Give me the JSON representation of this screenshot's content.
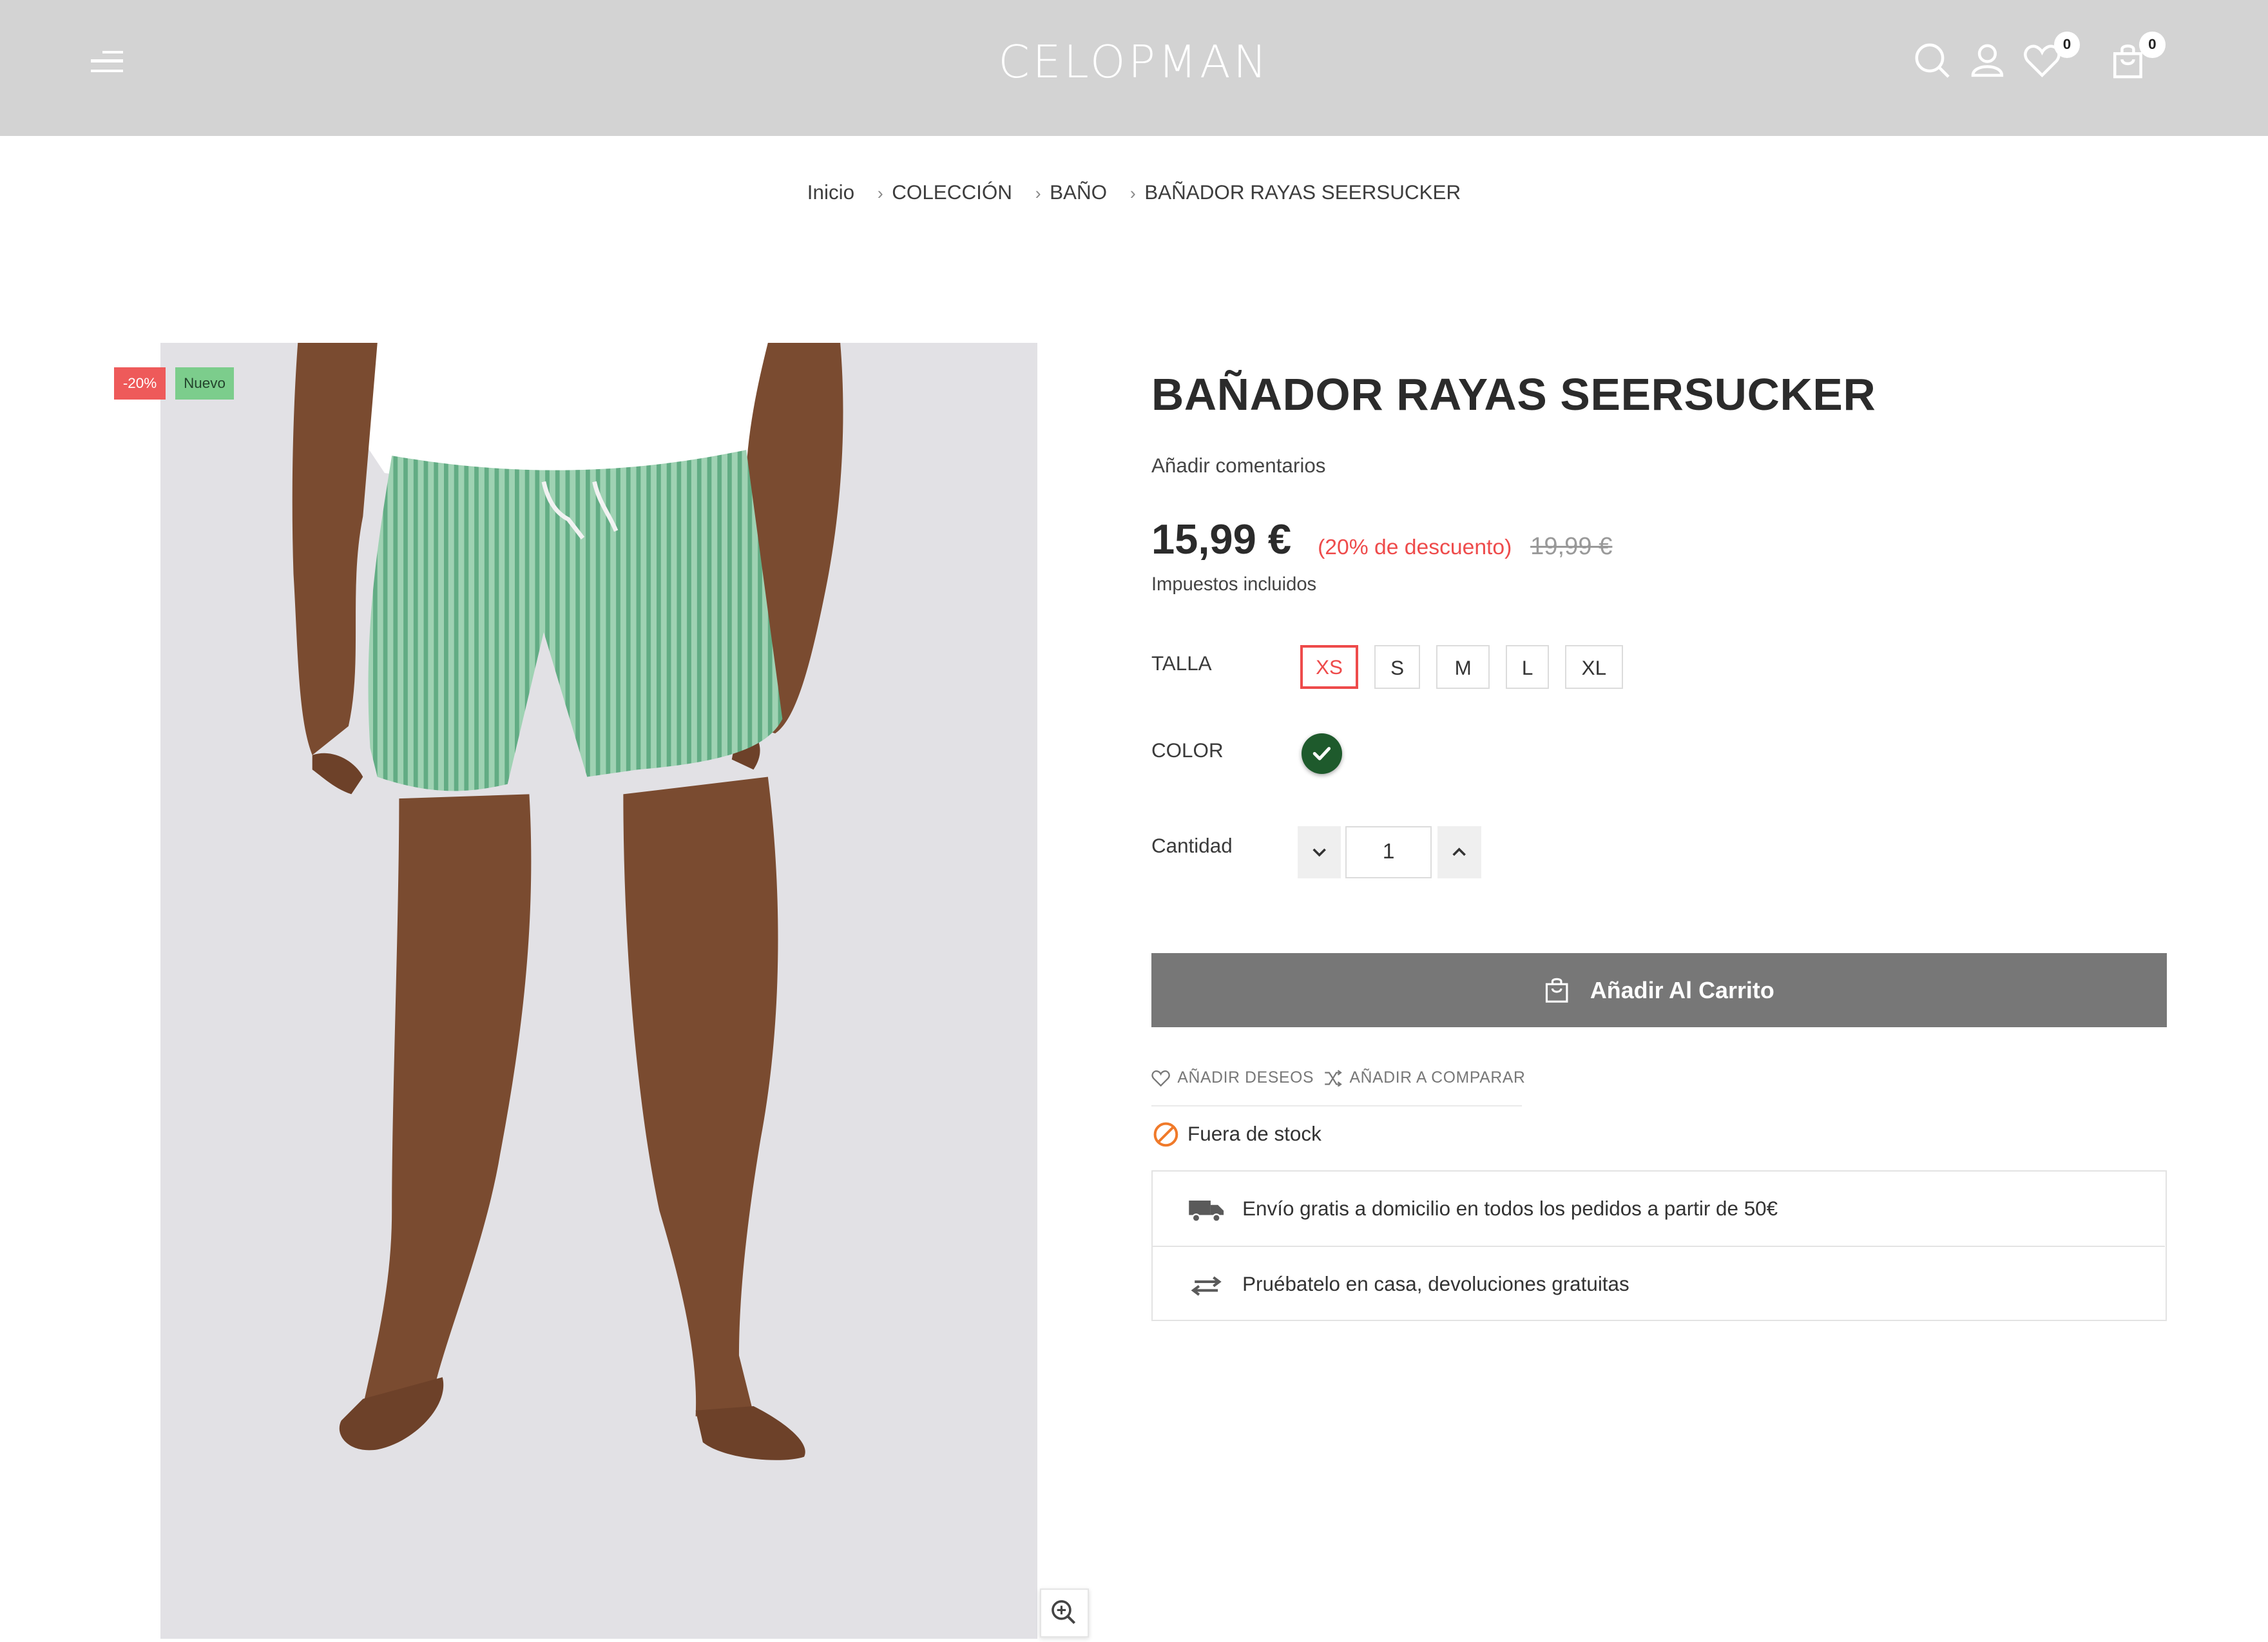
{
  "header": {
    "logo": "CELOPMAN",
    "menu_icon": "hamburger-menu-icon",
    "search_icon": "search-icon",
    "account_icon": "user-icon",
    "wishlist_icon": "heart-icon",
    "wishlist_count": "0",
    "cart_icon": "shopping-bag-icon",
    "cart_count": "0"
  },
  "breadcrumb": {
    "items": [
      "Inicio",
      "COLECCIÓN",
      "BAÑO",
      "BAÑADOR RAYAS SEERSUCKER"
    ],
    "separator": "›"
  },
  "product": {
    "image_alt": "Bañador rayas seersucker verde",
    "tags": {
      "discount": "-20%",
      "new": "Nuevo"
    },
    "title": "BAÑADOR RAYAS SEERSUCKER",
    "reviews_link": "Añadir comentarios",
    "price": "15,99 €",
    "discount_text": "(20% de descuento)",
    "old_price": "19,99 €",
    "tax_note": "Impuestos incluidos",
    "size_label": "TALLA",
    "sizes": [
      "XS",
      "S",
      "M",
      "L",
      "XL"
    ],
    "selected_size": "XS",
    "color_label": "COLOR",
    "selected_color": "#1e5a2c",
    "quantity_label": "Cantidad",
    "quantity": "1",
    "add_to_cart": "Añadir Al Carrito",
    "wishlist_link": "AÑADIR DESEOS",
    "compare_link": "AÑADIR A COMPARAR",
    "stock_status": "Fuera de stock",
    "info": [
      "Envío gratis a domicilio en todos los pedidos a partir de 50€",
      "Pruébatelo en casa, devoluciones gratuitas"
    ]
  },
  "colors": {
    "header_bg": "#d3d3d3",
    "accent_red": "#ee4b4b",
    "button_gray": "#777777",
    "new_tag": "#7ccd8c",
    "stock_icon": "#f07a2a"
  }
}
